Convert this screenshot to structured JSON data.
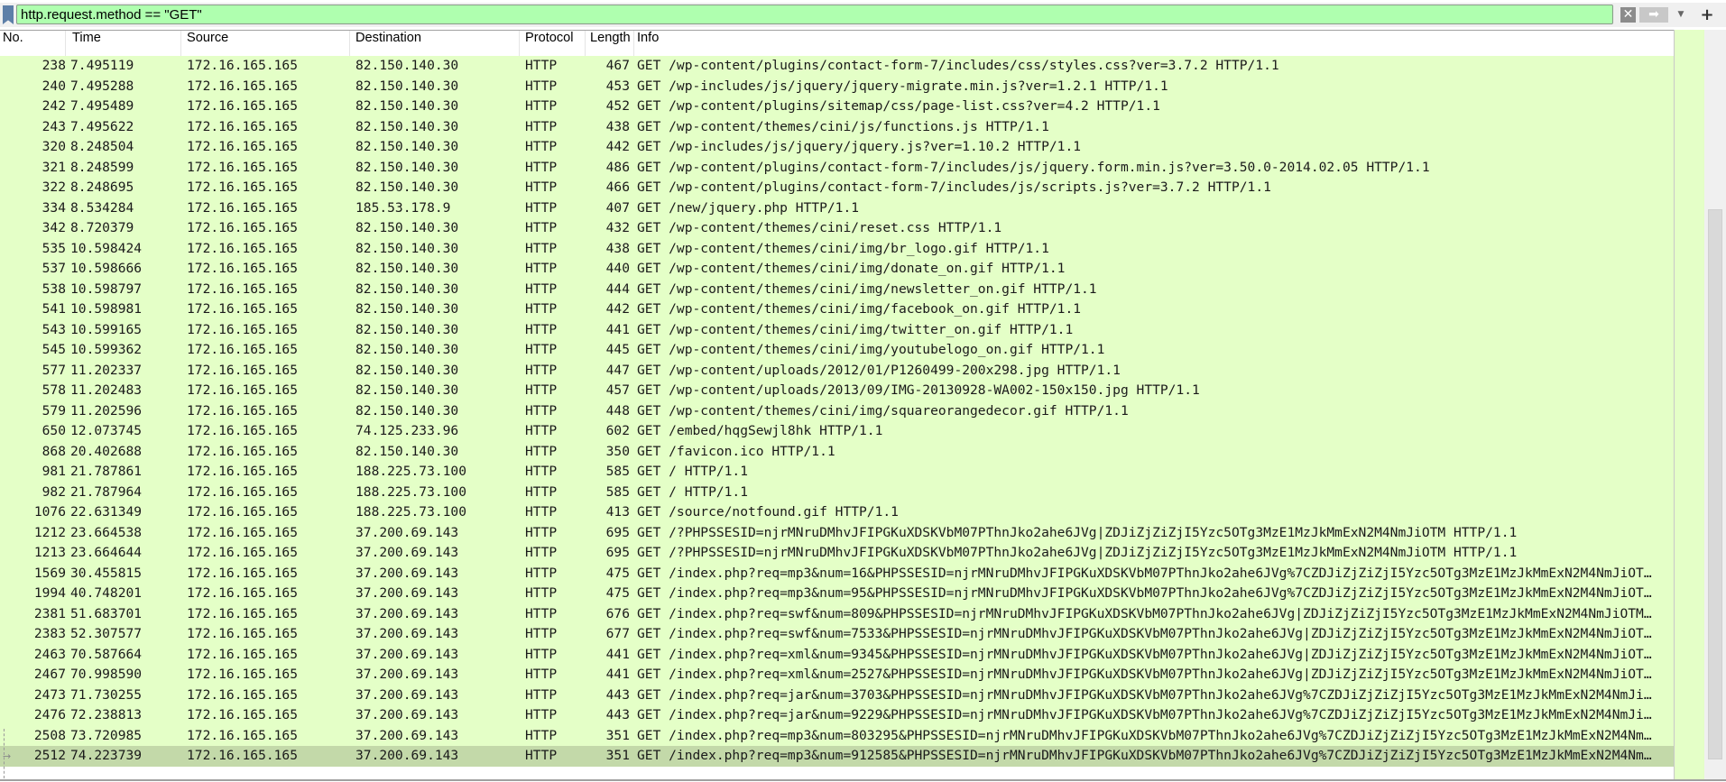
{
  "filter": {
    "value": "http.request.method == \"GET\"",
    "clear_icon": "✕",
    "apply_icon": "➡",
    "dropdown_icon": "▼",
    "add_label": "+"
  },
  "colors": {
    "filter_bg": "#afffaf",
    "row_bg": "#e4ffc7",
    "selected_bg": "#c3d9a9"
  },
  "columns": [
    "No.",
    "Time",
    "Source",
    "Destination",
    "Protocol",
    "Length",
    "Info"
  ],
  "selected_no": "2512",
  "packets": [
    {
      "no": "238",
      "time": "7.495119",
      "src": "172.16.165.165",
      "dst": "82.150.140.30",
      "proto": "HTTP",
      "len": "467",
      "info": "GET /wp-content/plugins/contact-form-7/includes/css/styles.css?ver=3.7.2 HTTP/1.1"
    },
    {
      "no": "240",
      "time": "7.495288",
      "src": "172.16.165.165",
      "dst": "82.150.140.30",
      "proto": "HTTP",
      "len": "453",
      "info": "GET /wp-includes/js/jquery/jquery-migrate.min.js?ver=1.2.1 HTTP/1.1"
    },
    {
      "no": "242",
      "time": "7.495489",
      "src": "172.16.165.165",
      "dst": "82.150.140.30",
      "proto": "HTTP",
      "len": "452",
      "info": "GET /wp-content/plugins/sitemap/css/page-list.css?ver=4.2 HTTP/1.1"
    },
    {
      "no": "243",
      "time": "7.495622",
      "src": "172.16.165.165",
      "dst": "82.150.140.30",
      "proto": "HTTP",
      "len": "438",
      "info": "GET /wp-content/themes/cini/js/functions.js HTTP/1.1"
    },
    {
      "no": "320",
      "time": "8.248504",
      "src": "172.16.165.165",
      "dst": "82.150.140.30",
      "proto": "HTTP",
      "len": "442",
      "info": "GET /wp-includes/js/jquery/jquery.js?ver=1.10.2 HTTP/1.1"
    },
    {
      "no": "321",
      "time": "8.248599",
      "src": "172.16.165.165",
      "dst": "82.150.140.30",
      "proto": "HTTP",
      "len": "486",
      "info": "GET /wp-content/plugins/contact-form-7/includes/js/jquery.form.min.js?ver=3.50.0-2014.02.05 HTTP/1.1"
    },
    {
      "no": "322",
      "time": "8.248695",
      "src": "172.16.165.165",
      "dst": "82.150.140.30",
      "proto": "HTTP",
      "len": "466",
      "info": "GET /wp-content/plugins/contact-form-7/includes/js/scripts.js?ver=3.7.2 HTTP/1.1"
    },
    {
      "no": "334",
      "time": "8.534284",
      "src": "172.16.165.165",
      "dst": "185.53.178.9",
      "proto": "HTTP",
      "len": "407",
      "info": "GET /new/jquery.php HTTP/1.1"
    },
    {
      "no": "342",
      "time": "8.720379",
      "src": "172.16.165.165",
      "dst": "82.150.140.30",
      "proto": "HTTP",
      "len": "432",
      "info": "GET /wp-content/themes/cini/reset.css HTTP/1.1"
    },
    {
      "no": "535",
      "time": "10.598424",
      "src": "172.16.165.165",
      "dst": "82.150.140.30",
      "proto": "HTTP",
      "len": "438",
      "info": "GET /wp-content/themes/cini/img/br_logo.gif HTTP/1.1"
    },
    {
      "no": "537",
      "time": "10.598666",
      "src": "172.16.165.165",
      "dst": "82.150.140.30",
      "proto": "HTTP",
      "len": "440",
      "info": "GET /wp-content/themes/cini/img/donate_on.gif HTTP/1.1"
    },
    {
      "no": "538",
      "time": "10.598797",
      "src": "172.16.165.165",
      "dst": "82.150.140.30",
      "proto": "HTTP",
      "len": "444",
      "info": "GET /wp-content/themes/cini/img/newsletter_on.gif HTTP/1.1"
    },
    {
      "no": "541",
      "time": "10.598981",
      "src": "172.16.165.165",
      "dst": "82.150.140.30",
      "proto": "HTTP",
      "len": "442",
      "info": "GET /wp-content/themes/cini/img/facebook_on.gif HTTP/1.1"
    },
    {
      "no": "543",
      "time": "10.599165",
      "src": "172.16.165.165",
      "dst": "82.150.140.30",
      "proto": "HTTP",
      "len": "441",
      "info": "GET /wp-content/themes/cini/img/twitter_on.gif HTTP/1.1"
    },
    {
      "no": "545",
      "time": "10.599362",
      "src": "172.16.165.165",
      "dst": "82.150.140.30",
      "proto": "HTTP",
      "len": "445",
      "info": "GET /wp-content/themes/cini/img/youtubelogo_on.gif HTTP/1.1"
    },
    {
      "no": "577",
      "time": "11.202337",
      "src": "172.16.165.165",
      "dst": "82.150.140.30",
      "proto": "HTTP",
      "len": "447",
      "info": "GET /wp-content/uploads/2012/01/P1260499-200x298.jpg HTTP/1.1"
    },
    {
      "no": "578",
      "time": "11.202483",
      "src": "172.16.165.165",
      "dst": "82.150.140.30",
      "proto": "HTTP",
      "len": "457",
      "info": "GET /wp-content/uploads/2013/09/IMG-20130928-WA002-150x150.jpg HTTP/1.1"
    },
    {
      "no": "579",
      "time": "11.202596",
      "src": "172.16.165.165",
      "dst": "82.150.140.30",
      "proto": "HTTP",
      "len": "448",
      "info": "GET /wp-content/themes/cini/img/squareorangedecor.gif HTTP/1.1"
    },
    {
      "no": "650",
      "time": "12.073745",
      "src": "172.16.165.165",
      "dst": "74.125.233.96",
      "proto": "HTTP",
      "len": "602",
      "info": "GET /embed/hqgSewjl8hk HTTP/1.1"
    },
    {
      "no": "868",
      "time": "20.402688",
      "src": "172.16.165.165",
      "dst": "82.150.140.30",
      "proto": "HTTP",
      "len": "350",
      "info": "GET /favicon.ico HTTP/1.1"
    },
    {
      "no": "981",
      "time": "21.787861",
      "src": "172.16.165.165",
      "dst": "188.225.73.100",
      "proto": "HTTP",
      "len": "585",
      "info": "GET / HTTP/1.1"
    },
    {
      "no": "982",
      "time": "21.787964",
      "src": "172.16.165.165",
      "dst": "188.225.73.100",
      "proto": "HTTP",
      "len": "585",
      "info": "GET / HTTP/1.1"
    },
    {
      "no": "1076",
      "time": "22.631349",
      "src": "172.16.165.165",
      "dst": "188.225.73.100",
      "proto": "HTTP",
      "len": "413",
      "info": "GET /source/notfound.gif HTTP/1.1"
    },
    {
      "no": "1212",
      "time": "23.664538",
      "src": "172.16.165.165",
      "dst": "37.200.69.143",
      "proto": "HTTP",
      "len": "695",
      "info": "GET /?PHPSSESID=njrMNruDMhvJFIPGKuXDSKVbM07PThnJko2ahe6JVg|ZDJiZjZiZjI5Yzc5OTg3MzE1MzJkMmExN2M4NmJiOTM HTTP/1.1"
    },
    {
      "no": "1213",
      "time": "23.664644",
      "src": "172.16.165.165",
      "dst": "37.200.69.143",
      "proto": "HTTP",
      "len": "695",
      "info": "GET /?PHPSSESID=njrMNruDMhvJFIPGKuXDSKVbM07PThnJko2ahe6JVg|ZDJiZjZiZjI5Yzc5OTg3MzE1MzJkMmExN2M4NmJiOTM HTTP/1.1"
    },
    {
      "no": "1569",
      "time": "30.455815",
      "src": "172.16.165.165",
      "dst": "37.200.69.143",
      "proto": "HTTP",
      "len": "475",
      "info": "GET /index.php?req=mp3&num=16&PHPSSESID=njrMNruDMhvJFIPGKuXDSKVbM07PThnJko2ahe6JVg%7CZDJiZjZiZjI5Yzc5OTg3MzE1MzJkMmExN2M4NmJiOT…"
    },
    {
      "no": "1994",
      "time": "40.748201",
      "src": "172.16.165.165",
      "dst": "37.200.69.143",
      "proto": "HTTP",
      "len": "475",
      "info": "GET /index.php?req=mp3&num=95&PHPSSESID=njrMNruDMhvJFIPGKuXDSKVbM07PThnJko2ahe6JVg%7CZDJiZjZiZjI5Yzc5OTg3MzE1MzJkMmExN2M4NmJiOT…"
    },
    {
      "no": "2381",
      "time": "51.683701",
      "src": "172.16.165.165",
      "dst": "37.200.69.143",
      "proto": "HTTP",
      "len": "676",
      "info": "GET /index.php?req=swf&num=809&PHPSSESID=njrMNruDMhvJFIPGKuXDSKVbM07PThnJko2ahe6JVg|ZDJiZjZiZjI5Yzc5OTg3MzE1MzJkMmExN2M4NmJiOTM…"
    },
    {
      "no": "2383",
      "time": "52.307577",
      "src": "172.16.165.165",
      "dst": "37.200.69.143",
      "proto": "HTTP",
      "len": "677",
      "info": "GET /index.php?req=swf&num=7533&PHPSSESID=njrMNruDMhvJFIPGKuXDSKVbM07PThnJko2ahe6JVg|ZDJiZjZiZjI5Yzc5OTg3MzE1MzJkMmExN2M4NmJiOT…"
    },
    {
      "no": "2463",
      "time": "70.587664",
      "src": "172.16.165.165",
      "dst": "37.200.69.143",
      "proto": "HTTP",
      "len": "441",
      "info": "GET /index.php?req=xml&num=9345&PHPSSESID=njrMNruDMhvJFIPGKuXDSKVbM07PThnJko2ahe6JVg|ZDJiZjZiZjI5Yzc5OTg3MzE1MzJkMmExN2M4NmJiOT…"
    },
    {
      "no": "2467",
      "time": "70.998590",
      "src": "172.16.165.165",
      "dst": "37.200.69.143",
      "proto": "HTTP",
      "len": "441",
      "info": "GET /index.php?req=xml&num=2527&PHPSSESID=njrMNruDMhvJFIPGKuXDSKVbM07PThnJko2ahe6JVg|ZDJiZjZiZjI5Yzc5OTg3MzE1MzJkMmExN2M4NmJiOT…"
    },
    {
      "no": "2473",
      "time": "71.730255",
      "src": "172.16.165.165",
      "dst": "37.200.69.143",
      "proto": "HTTP",
      "len": "443",
      "info": "GET /index.php?req=jar&num=3703&PHPSSESID=njrMNruDMhvJFIPGKuXDSKVbM07PThnJko2ahe6JVg%7CZDJiZjZiZjI5Yzc5OTg3MzE1MzJkMmExN2M4NmJi…"
    },
    {
      "no": "2476",
      "time": "72.238813",
      "src": "172.16.165.165",
      "dst": "37.200.69.143",
      "proto": "HTTP",
      "len": "443",
      "info": "GET /index.php?req=jar&num=9229&PHPSSESID=njrMNruDMhvJFIPGKuXDSKVbM07PThnJko2ahe6JVg%7CZDJiZjZiZjI5Yzc5OTg3MzE1MzJkMmExN2M4NmJi…"
    },
    {
      "no": "2508",
      "time": "73.720985",
      "src": "172.16.165.165",
      "dst": "37.200.69.143",
      "proto": "HTTP",
      "len": "351",
      "info": "GET /index.php?req=mp3&num=803295&PHPSSESID=njrMNruDMhvJFIPGKuXDSKVbM07PThnJko2ahe6JVg%7CZDJiZjZiZjI5Yzc5OTg3MzE1MzJkMmExN2M4Nm…"
    },
    {
      "no": "2512",
      "time": "74.223739",
      "src": "172.16.165.165",
      "dst": "37.200.69.143",
      "proto": "HTTP",
      "len": "351",
      "info": "GET /index.php?req=mp3&num=912585&PHPSSESID=njrMNruDMhvJFIPGKuXDSKVbM07PThnJko2ahe6JVg%7CZDJiZjZiZjI5Yzc5OTg3MzE1MzJkMmExN2M4Nm…"
    }
  ]
}
